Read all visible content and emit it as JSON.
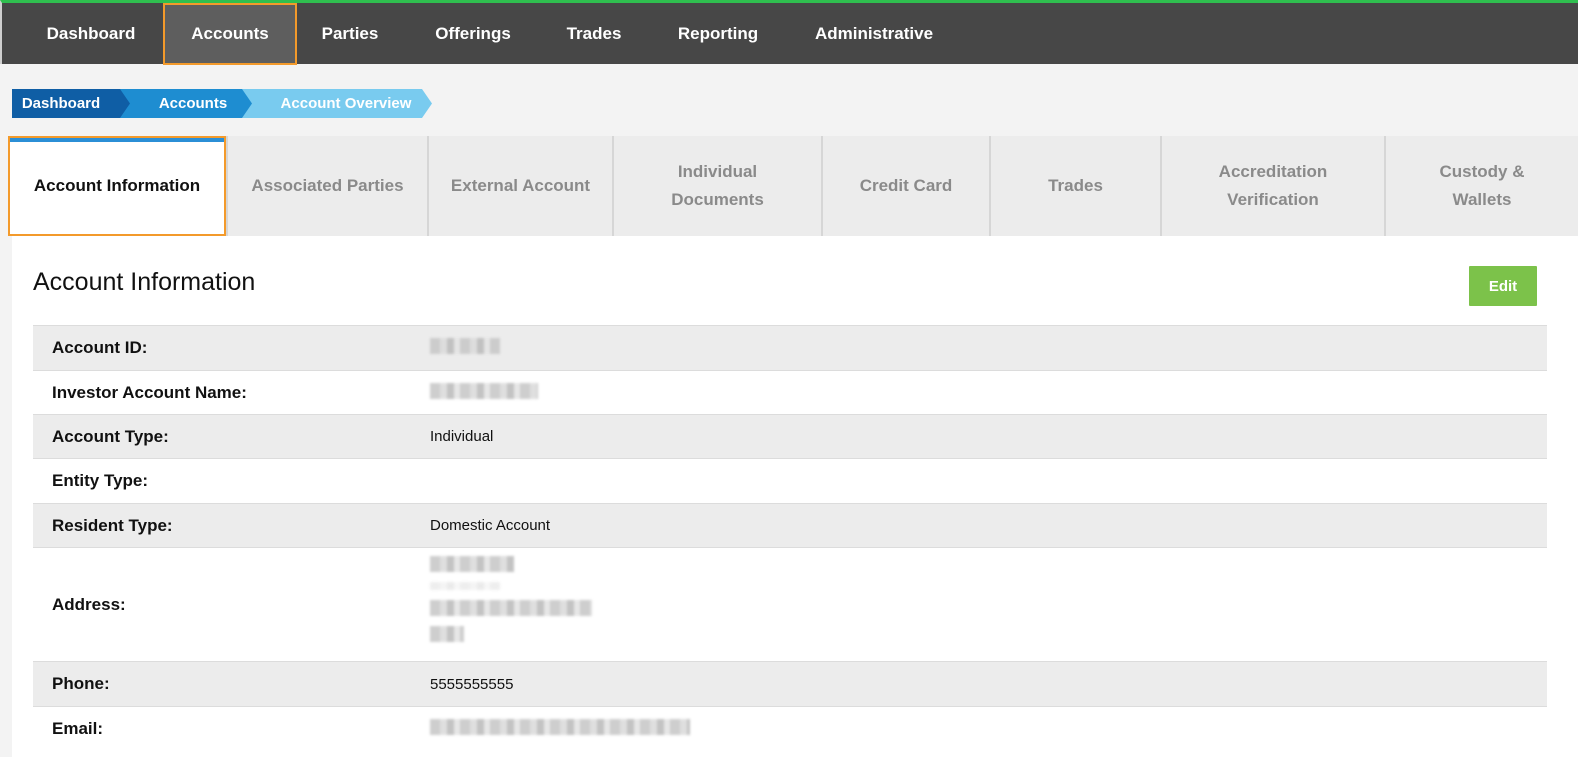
{
  "nav": {
    "items": [
      {
        "label": "Dashboard"
      },
      {
        "label": "Accounts",
        "active": true
      },
      {
        "label": "Parties"
      },
      {
        "label": "Offerings"
      },
      {
        "label": "Trades"
      },
      {
        "label": "Reporting"
      },
      {
        "label": "Administrative"
      }
    ]
  },
  "breadcrumb": [
    "Dashboard",
    "Accounts",
    "Account Overview"
  ],
  "tabs": [
    {
      "label": "Account Information",
      "active": true
    },
    {
      "label": "Associated Parties"
    },
    {
      "label": "External Account"
    },
    {
      "line1": "Individual",
      "line2": "Documents"
    },
    {
      "label": "Credit Card"
    },
    {
      "label": "Trades"
    },
    {
      "line1": "Accreditation",
      "line2": "Verification"
    },
    {
      "line1": "Custody &",
      "line2": "Wallets"
    }
  ],
  "panel": {
    "title": "Account Information",
    "edit_label": "Edit"
  },
  "fields": {
    "account_id": {
      "label": "Account ID:",
      "value": ""
    },
    "investor_name": {
      "label": "Investor Account Name:",
      "value": ""
    },
    "account_type": {
      "label": "Account Type:",
      "value": "Individual"
    },
    "entity_type": {
      "label": "Entity Type:",
      "value": ""
    },
    "resident_type": {
      "label": "Resident Type:",
      "value": "Domestic Account"
    },
    "address": {
      "label": "Address:"
    },
    "phone": {
      "label": "Phone:",
      "value": "5555555555"
    },
    "email": {
      "label": "Email:",
      "value": ""
    }
  },
  "colors": {
    "nav_bg": "#474747",
    "accent_green": "#2fbf4f",
    "highlight_orange": "#f39a2b",
    "edit_green": "#7cc24a",
    "crumb_dark": "#0f5ea5",
    "crumb_mid": "#1e8dd1",
    "crumb_light": "#79cbef"
  }
}
